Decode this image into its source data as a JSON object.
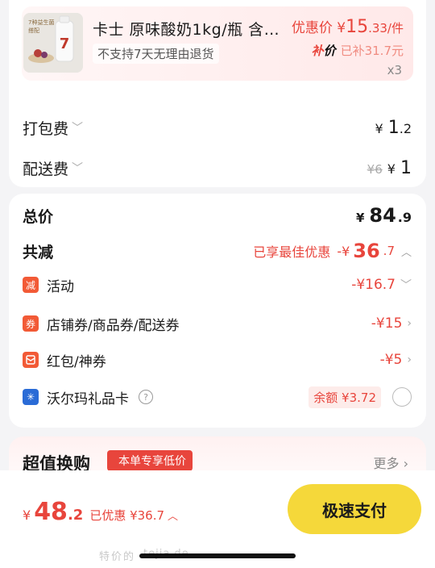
{
  "product": {
    "thumb_caption": "7种益生菌 搭配",
    "thumb_brand": "7",
    "title": "卡士 原味酸奶1kg/瓶 含…",
    "no_return": "不支持7天无理由退货",
    "price_prefix": "优惠价 ¥",
    "price_big": "15",
    "price_small": ".33/件",
    "subsidy_logo_a": "补",
    "subsidy_logo_b": "价",
    "subsidy_text": "已补31.7元",
    "qty": "x3"
  },
  "fees": {
    "packing": {
      "label": "打包费",
      "yen": "¥",
      "big": "1",
      "small": ".2"
    },
    "delivery": {
      "label": "配送费",
      "original": "¥6",
      "yen": "¥",
      "big": "1"
    }
  },
  "summary": {
    "total_label": "总价",
    "total_yen": "¥",
    "total_big": "84",
    "total_small": ".9",
    "discount_label": "共减",
    "discount_note": "已享最佳优惠",
    "discount_minus": "-¥",
    "discount_big": "36",
    "discount_small": ".7",
    "items": [
      {
        "badge": "减",
        "label": "活动",
        "value": "-¥16.7"
      },
      {
        "badge": "券",
        "label": "店铺券/商品券/配送券",
        "value": "-¥15"
      },
      {
        "badge": "红",
        "label": "红包/神券",
        "value": "-¥5"
      },
      {
        "badge": "✳",
        "label": "沃尔玛礼品卡",
        "balance": "余额 ¥3.72"
      }
    ]
  },
  "promo": {
    "title": "超值换购",
    "tag": "本单专享低价",
    "more": "更多"
  },
  "footer": {
    "yen": "¥",
    "pay_big": "48",
    "pay_small": ".2",
    "discounted": "已优惠 ¥36.7",
    "pay_button": "极速支付",
    "watermark": "特价的",
    "watermark_site": "tejia.de"
  },
  "colors": {
    "accent_red": "#e8453c",
    "pay_yellow": "#f5d83a"
  }
}
